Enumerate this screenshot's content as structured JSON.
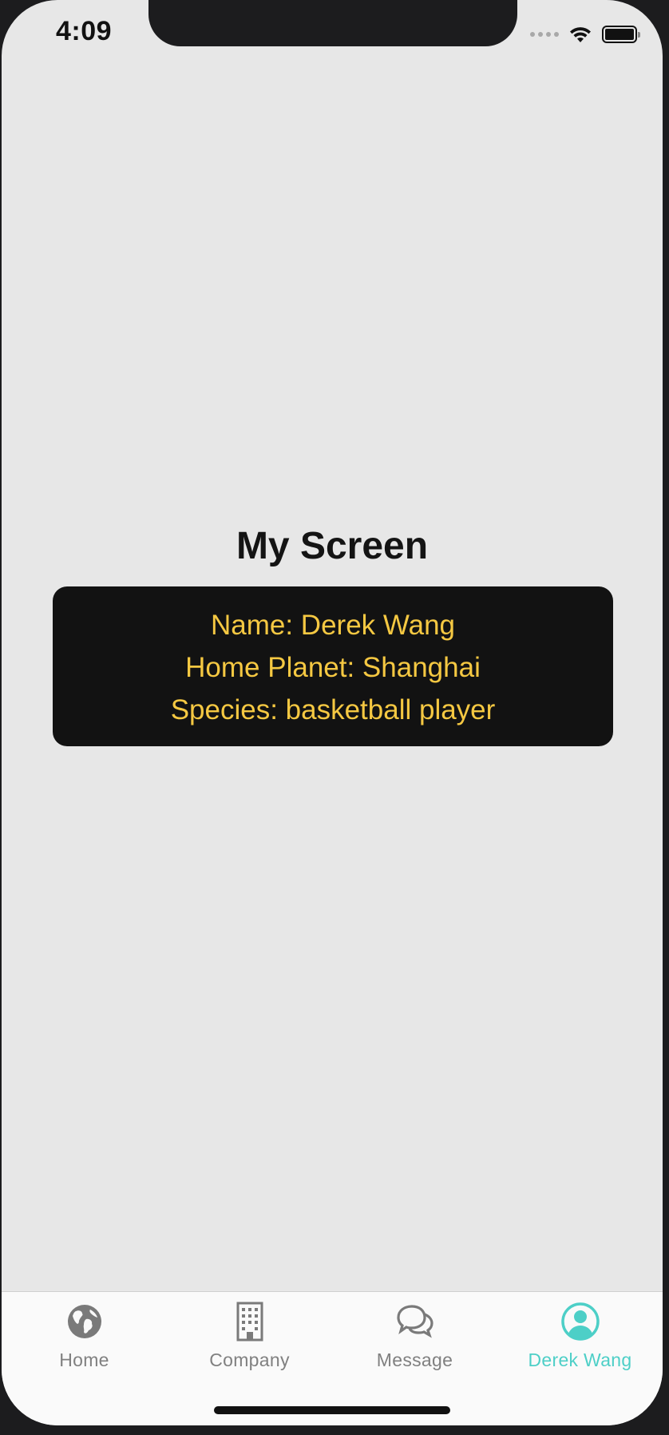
{
  "status_bar": {
    "time": "4:09"
  },
  "screen": {
    "title": "My Screen",
    "profile": {
      "name_line": "Name: Derek Wang",
      "planet_line": "Home Planet: Shanghai",
      "species_line": "Species: basketball player"
    }
  },
  "tab_bar": {
    "tabs": [
      {
        "label": "Home",
        "icon": "globe-icon",
        "active": false
      },
      {
        "label": "Company",
        "icon": "building-icon",
        "active": false
      },
      {
        "label": "Message",
        "icon": "chat-bubbles-icon",
        "active": false
      },
      {
        "label": "Derek Wang",
        "icon": "user-circle-icon",
        "active": true
      }
    ]
  },
  "colors": {
    "background": "#e7e7e7",
    "card": "#121212",
    "card_text": "#f5c842",
    "active_tab": "#4dcfc7",
    "inactive_tab": "#808080"
  }
}
